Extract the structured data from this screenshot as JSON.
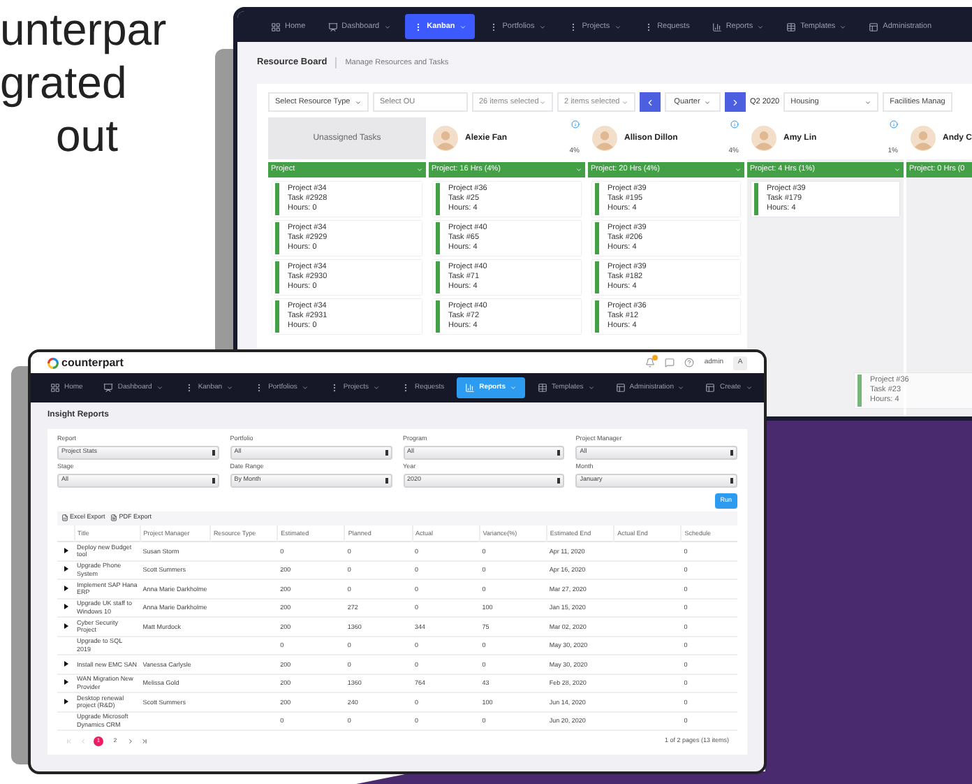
{
  "headline_lines": [
    "unterpar",
    "grated",
    "out"
  ],
  "kanban_window": {
    "nav": [
      {
        "label": "Home",
        "selected": false,
        "dropdown": false
      },
      {
        "label": "Dashboard",
        "selected": false,
        "dropdown": true
      },
      {
        "label": "Kanban",
        "selected": true,
        "dropdown": true
      },
      {
        "label": "Portfolios",
        "selected": false,
        "dropdown": true
      },
      {
        "label": "Projects",
        "selected": false,
        "dropdown": true
      },
      {
        "label": "Requests",
        "selected": false,
        "dropdown": false
      },
      {
        "label": "Reports",
        "selected": false,
        "dropdown": true
      },
      {
        "label": "Templates",
        "selected": false,
        "dropdown": true
      },
      {
        "label": "Administration",
        "selected": false,
        "dropdown": false
      }
    ],
    "title": "Resource Board",
    "subtitle": "Manage Resources and Tasks",
    "filters": {
      "resource_type": "Select Resource Type",
      "ou_placeholder": "Select OU",
      "multi_1": "26 items selected",
      "multi_2": "2 items selected",
      "period": "Quarter",
      "period_label": "Q2 2020",
      "category": "Housing",
      "department": "Facilities Manag"
    },
    "columns": [
      {
        "kind": "unassigned",
        "name": "Unassigned Tasks",
        "group": "Project",
        "tasks": [
          {
            "project": "Project #34",
            "task": "Task #2928",
            "hours": "Hours: 0"
          },
          {
            "project": "Project #34",
            "task": "Task #2929",
            "hours": "Hours: 0"
          },
          {
            "project": "Project #34",
            "task": "Task #2930",
            "hours": "Hours: 0"
          },
          {
            "project": "Project #34",
            "task": "Task #2931",
            "hours": "Hours: 0"
          }
        ]
      },
      {
        "kind": "person",
        "name": "Alexie Fan",
        "percent": "4%",
        "group": "Project: 16 Hrs (4%)",
        "tasks": [
          {
            "project": "Project #36",
            "task": "Task #25",
            "hours": "Hours: 4"
          },
          {
            "project": "Project #40",
            "task": "Task #65",
            "hours": "Hours: 4"
          },
          {
            "project": "Project #40",
            "task": "Task #71",
            "hours": "Hours: 4"
          },
          {
            "project": "Project #40",
            "task": "Task #72",
            "hours": "Hours: 4"
          }
        ]
      },
      {
        "kind": "person",
        "name": "Allison Dillon",
        "percent": "4%",
        "group": "Project: 20 Hrs (4%)",
        "tasks": [
          {
            "project": "Project #39",
            "task": "Task #195",
            "hours": "Hours: 4"
          },
          {
            "project": "Project #39",
            "task": "Task #206",
            "hours": "Hours: 4"
          },
          {
            "project": "Project #39",
            "task": "Task #182",
            "hours": "Hours: 4"
          },
          {
            "project": "Project #36",
            "task": "Task #12",
            "hours": "Hours: 4"
          }
        ]
      },
      {
        "kind": "person",
        "name": "Amy Lin",
        "percent": "1%",
        "group": "Project: 4 Hrs (1%)",
        "tasks": [
          {
            "project": "Project #39",
            "task": "Task #179",
            "hours": "Hours: 4"
          }
        ]
      },
      {
        "kind": "person",
        "name": "Andy C",
        "group": "Project: 0 Hrs (0"
      }
    ],
    "dragged_task": {
      "project": "Project #36",
      "task": "Task #23",
      "hours": "Hours: 4"
    }
  },
  "reports_window": {
    "logo": "counterpart",
    "user": "admin",
    "avatar_letter": "A",
    "nav": [
      {
        "label": "Home",
        "selected": false,
        "dropdown": false
      },
      {
        "label": "Dashboard",
        "selected": false,
        "dropdown": true
      },
      {
        "label": "Kanban",
        "selected": false,
        "dropdown": true
      },
      {
        "label": "Portfolios",
        "selected": false,
        "dropdown": true
      },
      {
        "label": "Projects",
        "selected": false,
        "dropdown": true
      },
      {
        "label": "Requests",
        "selected": false,
        "dropdown": false
      },
      {
        "label": "Reports",
        "selected": true,
        "dropdown": true
      },
      {
        "label": "Templates",
        "selected": false,
        "dropdown": true
      },
      {
        "label": "Administration",
        "selected": false,
        "dropdown": true
      },
      {
        "label": "Create",
        "selected": false,
        "dropdown": true
      }
    ],
    "title": "Insight Reports",
    "fields": [
      {
        "label": "Report",
        "value": "Project Stats"
      },
      {
        "label": "Portfolio",
        "value": "All"
      },
      {
        "label": "Program",
        "value": "All"
      },
      {
        "label": "Project Manager",
        "value": "All"
      },
      {
        "label": "Stage",
        "value": "All"
      },
      {
        "label": "Date Range",
        "value": "By Month"
      },
      {
        "label": "Year",
        "value": "2020"
      },
      {
        "label": "Month",
        "value": "January"
      }
    ],
    "run_button": "Run",
    "exports": [
      "Excel Export",
      "PDF Export"
    ],
    "table": {
      "columns": [
        "Title",
        "Project Manager",
        "Resource Type",
        "Estimated",
        "Planned",
        "Actual",
        "Variance(%)",
        "Estimated End",
        "Actual End",
        "Schedule"
      ],
      "rows": [
        {
          "expandable": true,
          "cells": [
            "Deploy new Budget tool",
            "Susan Storm",
            "",
            "0",
            "0",
            "0",
            "0",
            "Apr 11, 2020",
            "",
            "0"
          ]
        },
        {
          "expandable": true,
          "cells": [
            "Upgrade Phone System",
            "Scott Summers",
            "",
            "200",
            "0",
            "0",
            "0",
            "Apr 16, 2020",
            "",
            "0"
          ]
        },
        {
          "expandable": true,
          "cells": [
            "Implement SAP Hana ERP",
            "Anna Marie Darkholme",
            "",
            "200",
            "0",
            "0",
            "0",
            "Mar 27, 2020",
            "",
            "0"
          ]
        },
        {
          "expandable": true,
          "cells": [
            "Upgrade UK staff to Windows 10",
            "Anna Marie Darkholme",
            "",
            "200",
            "272",
            "0",
            "100",
            "Jan 15, 2020",
            "",
            "0"
          ]
        },
        {
          "expandable": true,
          "cells": [
            "Cyber Security Project",
            "Matt Murdock",
            "",
            "200",
            "1360",
            "344",
            "75",
            "Mar 02, 2020",
            "",
            "0"
          ]
        },
        {
          "expandable": false,
          "cells": [
            "Upgrade to SQL 2019",
            "",
            "",
            "0",
            "0",
            "0",
            "0",
            "May 30, 2020",
            "",
            "0"
          ]
        },
        {
          "expandable": true,
          "cells": [
            "Install new EMC SAN",
            "Vanessa Carlysle",
            "",
            "200",
            "0",
            "0",
            "0",
            "May 30, 2020",
            "",
            "0"
          ]
        },
        {
          "expandable": true,
          "cells": [
            "WAN Migration New Provider",
            "Melissa Gold",
            "",
            "200",
            "1360",
            "764",
            "43",
            "Feb 28, 2020",
            "",
            "0"
          ]
        },
        {
          "expandable": true,
          "cells": [
            "Desktop renewal project (R&D)",
            "Scott Summers",
            "",
            "200",
            "240",
            "0",
            "100",
            "Jun 14, 2020",
            "",
            "0"
          ]
        },
        {
          "expandable": false,
          "cells": [
            "Upgrade Microsoft Dynamics CRM",
            "",
            "",
            "0",
            "0",
            "0",
            "0",
            "Jun 20, 2020",
            "",
            "0"
          ]
        }
      ]
    },
    "pages": [
      {
        "label": "1",
        "selected": true
      },
      {
        "label": "2",
        "selected": false
      }
    ],
    "page_info": "1 of 2 pages (13 items)"
  }
}
